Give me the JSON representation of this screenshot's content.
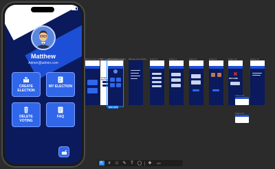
{
  "app": {
    "status_time": "9:41",
    "user_name": "Matthew",
    "user_email": "Admin@admin.com",
    "tiles": [
      {
        "label": "CREATE ELECTION",
        "icon": "ballot-box-icon"
      },
      {
        "label": "MY ELECTION",
        "icon": "checklist-icon"
      },
      {
        "label": "DELETE VOTING",
        "icon": "trash-icon"
      },
      {
        "label": "FAQ",
        "icon": "faq-list-icon"
      }
    ],
    "fab_icon": "vote-icon"
  },
  "canvas": {
    "frames": [
      {
        "label": "iPhone 14 & 15 Pro"
      },
      {
        "label": "iPhone 14 & 15 Pro"
      },
      {
        "label": "iPhone 14 & 15 Pro"
      },
      {
        "label": "iPhone 14 & 15 Pro"
      },
      {
        "label": "Frame 6"
      },
      {
        "label": "Frame 7"
      },
      {
        "label": "Frame 8"
      },
      {
        "label": "Frame 9"
      },
      {
        "label": "Frame 10"
      },
      {
        "label": "Frame 11"
      },
      {
        "label": "Frame 12"
      }
    ],
    "frame_titles": {
      "forgot_password": "Forgot Password",
      "welcome": "WELCOME"
    },
    "selection_tag": "402 × 874",
    "side_cards": [
      {
        "label": "Frame 13"
      },
      {
        "label": "Frame 14"
      }
    ]
  },
  "toolbar": {
    "tools": [
      {
        "name": "move-tool",
        "glyph": "⇱"
      },
      {
        "name": "frame-tool",
        "glyph": "#"
      },
      {
        "name": "rectangle-tool",
        "glyph": "□"
      },
      {
        "name": "pen-tool",
        "glyph": "✎"
      },
      {
        "name": "text-tool",
        "glyph": "T"
      },
      {
        "name": "comment-tool",
        "glyph": "◯"
      },
      {
        "name": "component-tool",
        "glyph": "❖"
      },
      {
        "name": "dev-mode-toggle",
        "glyph": "</>"
      }
    ]
  },
  "colors": {
    "primary_dark": "#0a1a5c",
    "primary": "#2f66ea",
    "accent_blue": "#1d4fd6",
    "selection": "#1e88ff",
    "canvas_bg": "#2b2b2b",
    "danger": "#e53935"
  }
}
